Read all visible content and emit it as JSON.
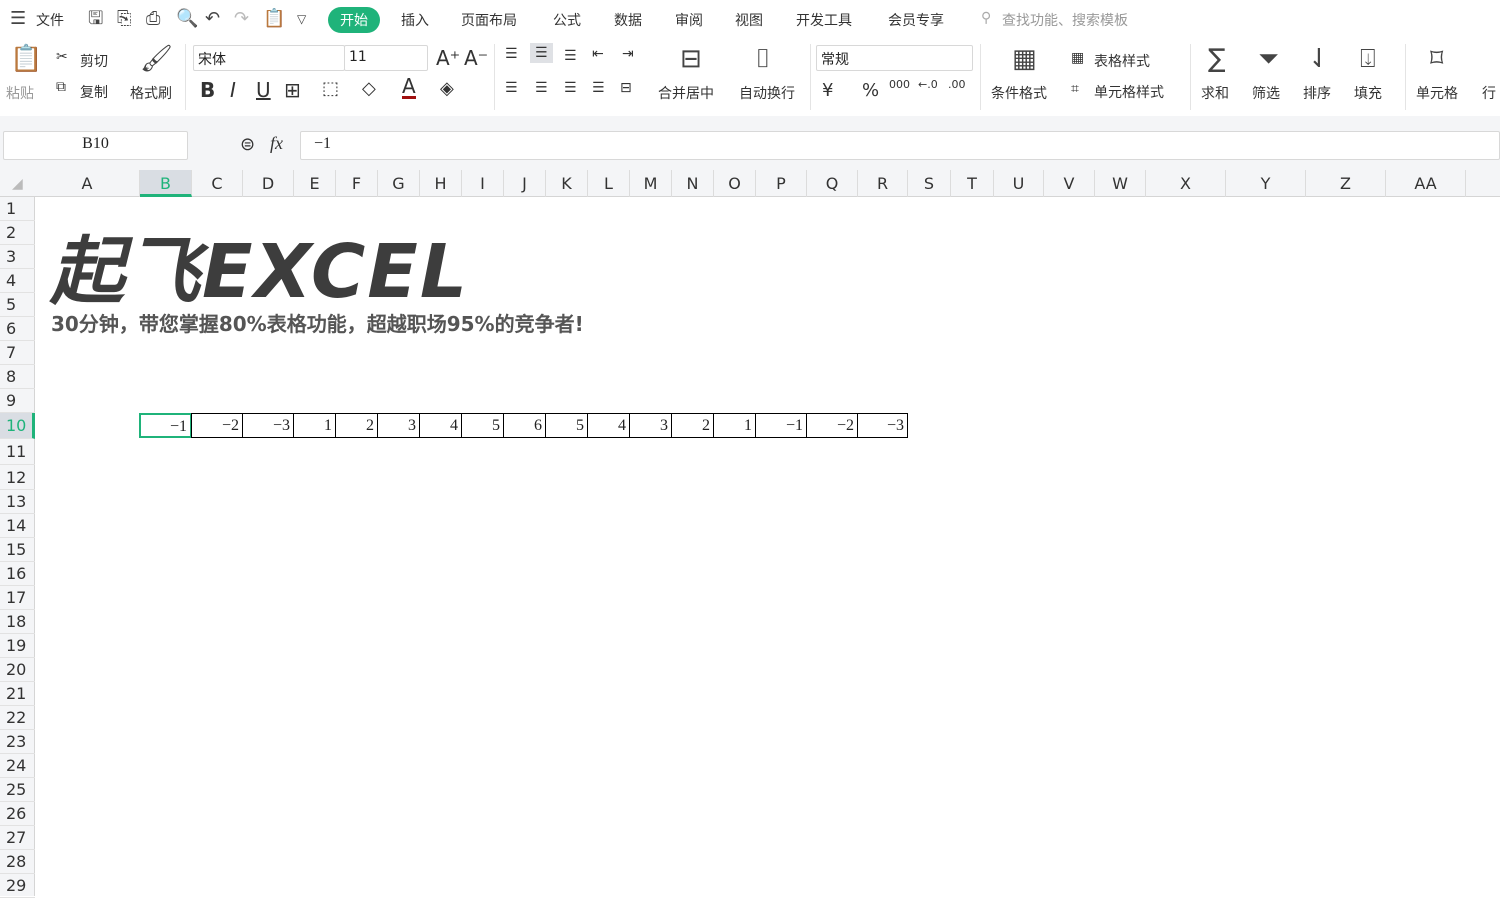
{
  "menu": {
    "file": "文件",
    "tabs": [
      "开始",
      "插入",
      "页面布局",
      "公式",
      "数据",
      "审阅",
      "视图",
      "开发工具",
      "会员专享"
    ],
    "search_placeholder": "查找功能、搜索模板"
  },
  "ribbon": {
    "paste": "粘贴",
    "cut": "剪切",
    "copy": "复制",
    "format_painter": "格式刷",
    "font": "宋体",
    "size": "11",
    "bold": "B",
    "italic": "I",
    "underline": "U",
    "merge": "合并居中",
    "wrap": "自动换行",
    "number_format": "常规",
    "currency": "¥",
    "percent": "%",
    "thousands": "000",
    "cond_format": "条件格式",
    "table_style": "表格样式",
    "cell_style": "单元格样式",
    "sum": "求和",
    "filter": "筛选",
    "sort": "排序",
    "fill": "填充",
    "cells": "单元格",
    "rows_cols": "行"
  },
  "formula": {
    "name_box": "B10",
    "fx": "fx",
    "value": "−1"
  },
  "columns": [
    "A",
    "B",
    "C",
    "D",
    "E",
    "F",
    "G",
    "H",
    "I",
    "J",
    "K",
    "L",
    "M",
    "N",
    "O",
    "P",
    "Q",
    "R",
    "S",
    "T",
    "U",
    "V",
    "W",
    "X",
    "Y",
    "Z",
    "AA"
  ],
  "rows": [
    "1",
    "2",
    "3",
    "4",
    "5",
    "6",
    "7",
    "8",
    "9",
    "10",
    "11",
    "12",
    "13",
    "14",
    "15",
    "16",
    "17",
    "18",
    "19",
    "20",
    "21",
    "22",
    "23",
    "24",
    "25",
    "26",
    "27",
    "28",
    "29"
  ],
  "sheet": {
    "title": "起飞EXCEL",
    "subtitle": "30分钟，带您掌握80%表格功能，超越职场95%的竞争者!",
    "row10": [
      "−1",
      "−2",
      "−3",
      "1",
      "2",
      "3",
      "4",
      "5",
      "6",
      "5",
      "4",
      "3",
      "2",
      "1",
      "−1",
      "−2",
      "−3"
    ]
  },
  "colors": {
    "accent": "#1fb37a"
  }
}
